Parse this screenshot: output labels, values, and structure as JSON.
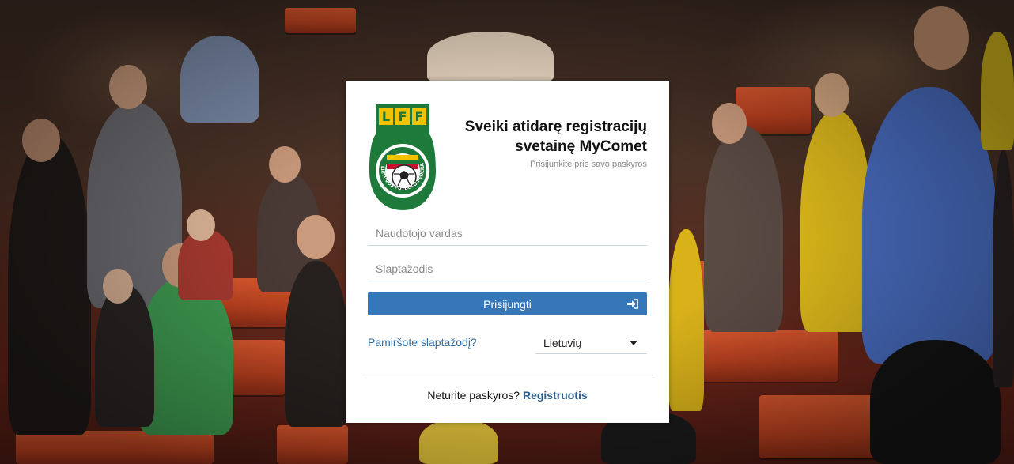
{
  "page": {
    "brand_color": "#3677b9",
    "link_color": "#2e6da4"
  },
  "logo": {
    "icon": "lff-football-federation-logo",
    "letters": "LFF",
    "ring_text": "LIETUVOS FUTBOLO FEDERACIJA",
    "colors": {
      "green": "#1e7a3a",
      "gold": "#f2c200",
      "red": "#c8102e"
    }
  },
  "header": {
    "title": "Sveiki atidarę registracijų\nsvetainę MyComet",
    "subtitle": "Prisijunkite prie savo paskyros"
  },
  "form": {
    "username_placeholder": "Naudotojo vardas",
    "username_value": "",
    "password_placeholder": "Slaptažodis",
    "password_value": "",
    "login_label": "Prisijungti",
    "login_icon": "sign-in-icon"
  },
  "footer": {
    "forgot_label": "Pamiršote slaptažodį?",
    "language_selected": "Lietuvių",
    "no_account_text": "Neturite paskyros?",
    "register_label": "Registruotis"
  }
}
